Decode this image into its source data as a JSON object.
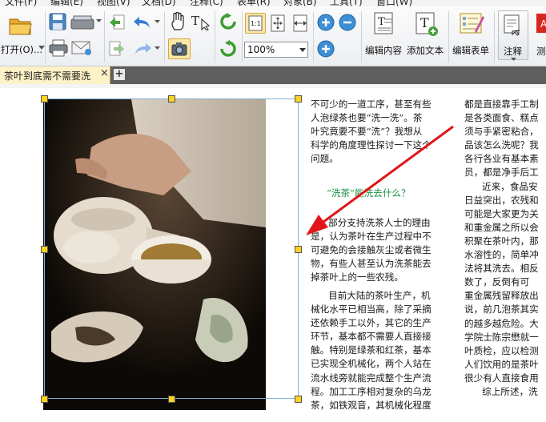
{
  "menu": [
    "文件(F)",
    "编辑(E)",
    "视图(V)",
    "文档(D)",
    "注释(C)",
    "表单(R)",
    "对象(B)",
    "工具(T)",
    "窗口(W)"
  ],
  "toolbar": {
    "open_label": "打开(O)...",
    "zoom_value": "100%",
    "edit_content_label": "编辑内容",
    "add_text_label": "添加文本",
    "edit_form_label": "编辑表单",
    "annotate_label": "注释",
    "truncated_label": "测"
  },
  "tab": {
    "title": "茶叶到底需不需要洗",
    "close_glyph": "×",
    "new_glyph": "+"
  },
  "article": {
    "col1_p1": "不可少的一道工序，甚至有些\n人泡绿茶也要“洗一洗”。茶\n叶究竟要不要“洗”？我想从\n科学的角度理性探讨一下这个\n问题。",
    "col1_heading": "“洗茶”能洗去什么？",
    "col1_p2": "      部分支持洗茶人士的理由\n是，认为茶叶在生产过程中不\n可避免的会接触灰尘或者微生\n物，有些人甚至认为洗茶能去\n掉茶叶上的一些农残。",
    "col1_p3": "      目前大陆的茶叶生产，机\n械化水平已相当高，除了采摘\n还依赖手工以外，其它的生产\n环节，基本都不需要人直接接\n触。特别是绿茶和红茶，基本\n已实现全机械化，两个人站在\n流水线旁就能完成整个生产流\n程。加工工序相对复杂的乌龙\n茶，如铁观音，其机械化程度",
    "col2": "都是直接靠手工制\n是各类面食、糕点\n须与手紧密粘合，\n品该怎么洗呢？我\n各行各业有基本素\n员，都是净手后工\n      近来，食品安\n日益突出，农残和\n可能是大家更为关\n和重金属之所以会\n积聚在茶叶内，那\n水溶性的，简单冲\n法将其洗去。相反\n数了，反倒有可\n重金属残留释放出\n说，前几泡茶其实\n的越多越危险。大\n学院士陈宗懋就一\n叶质检，应以检测\n人们饮用的是茶叶\n很少有人直接食用\n      综上所述，洗"
  },
  "colors": {
    "accent_arrow": "#e0161b",
    "heading_green": "#1f8f46",
    "selection_border": "#7fb1d9",
    "handle_yellow": "#ffd21e",
    "tab_active": "#fdf1c6",
    "tab_bar": "#5e5e5e"
  },
  "icons": [
    "folder-open-icon",
    "save-icon",
    "scanner-icon",
    "print-icon",
    "email-icon",
    "page-back-icon",
    "page-forward-icon",
    "undo-icon",
    "redo-icon",
    "hand-tool-icon",
    "select-text-icon",
    "snapshot-icon",
    "rotate-cw-icon",
    "rotate-ccw-icon",
    "actual-size-icon",
    "fit-page-icon",
    "fit-width-icon",
    "zoom-in-icon",
    "zoom-out-icon",
    "edit-content-icon",
    "add-text-icon",
    "edit-form-icon",
    "annotate-icon"
  ]
}
